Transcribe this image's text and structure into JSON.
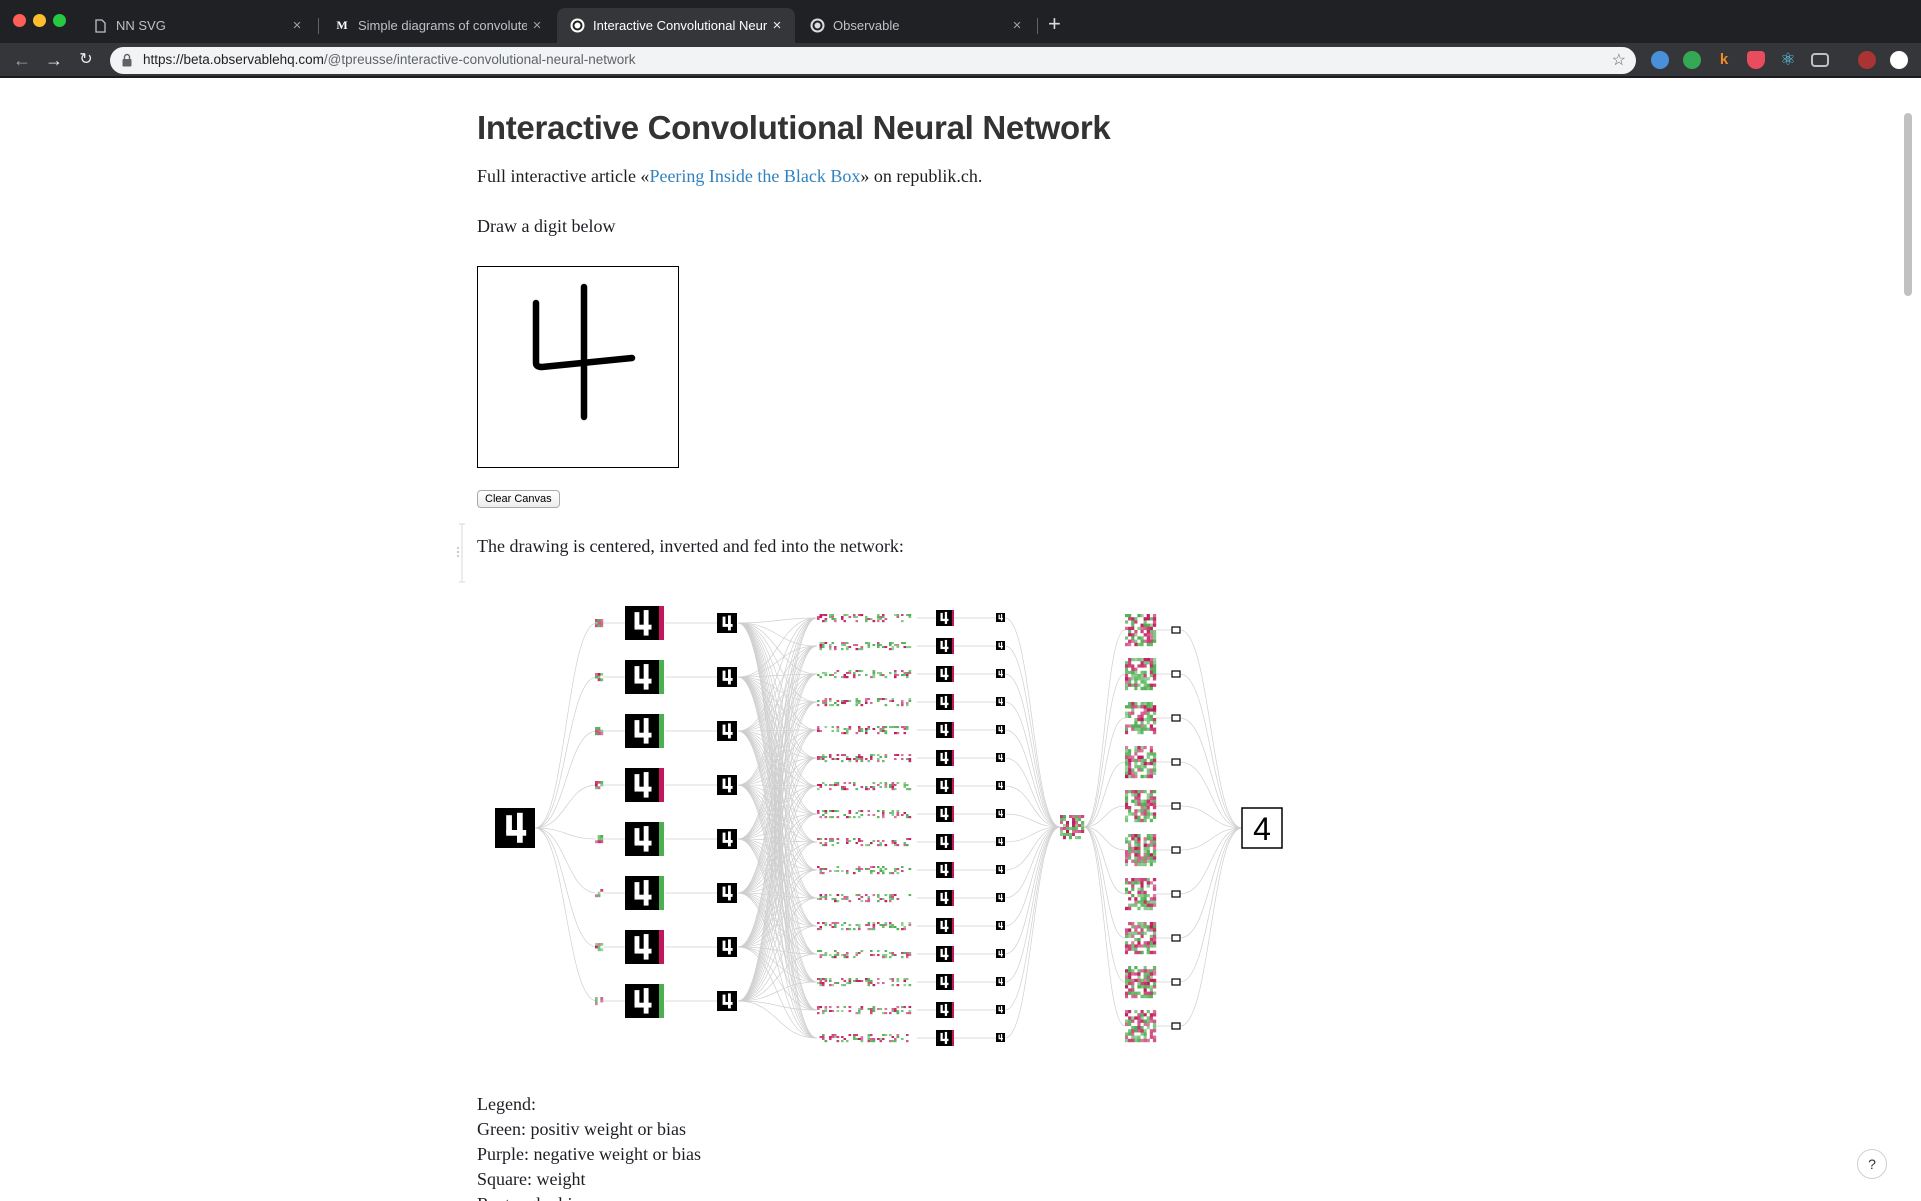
{
  "browser": {
    "tabs": [
      {
        "title": "NN SVG",
        "icon": "document-icon"
      },
      {
        "title": "Simple diagrams of convoluted",
        "icon": "medium-icon"
      },
      {
        "title": "Interactive Convolutional Neural",
        "icon": "observable-icon"
      },
      {
        "title": "Observable",
        "icon": "observable-icon"
      }
    ],
    "url_host": "https://beta.observablehq.com",
    "url_path": "/@tpreusse/interactive-convolutional-neural-network"
  },
  "page": {
    "title": "Interactive Convolutional Neural Network",
    "intro_prefix": "Full interactive article «",
    "intro_link": "Peering Inside the Black Box",
    "intro_suffix": "» on republik.ch.",
    "draw_prompt": "Draw a digit below",
    "clear_button": "Clear Canvas",
    "network_caption": "The drawing is centered, inverted and fed into the network:",
    "prediction": "4",
    "legend": {
      "heading": "Legend:",
      "green": "Green: positiv weight or bias",
      "purple": "Purple: negative weight or bias",
      "square": "Square: weight",
      "rectangle": "Rectangle: bias"
    },
    "help_label": "?"
  },
  "colors": {
    "positive": "#4caf50",
    "negative": "#c2185b",
    "link": "#3182bd"
  }
}
